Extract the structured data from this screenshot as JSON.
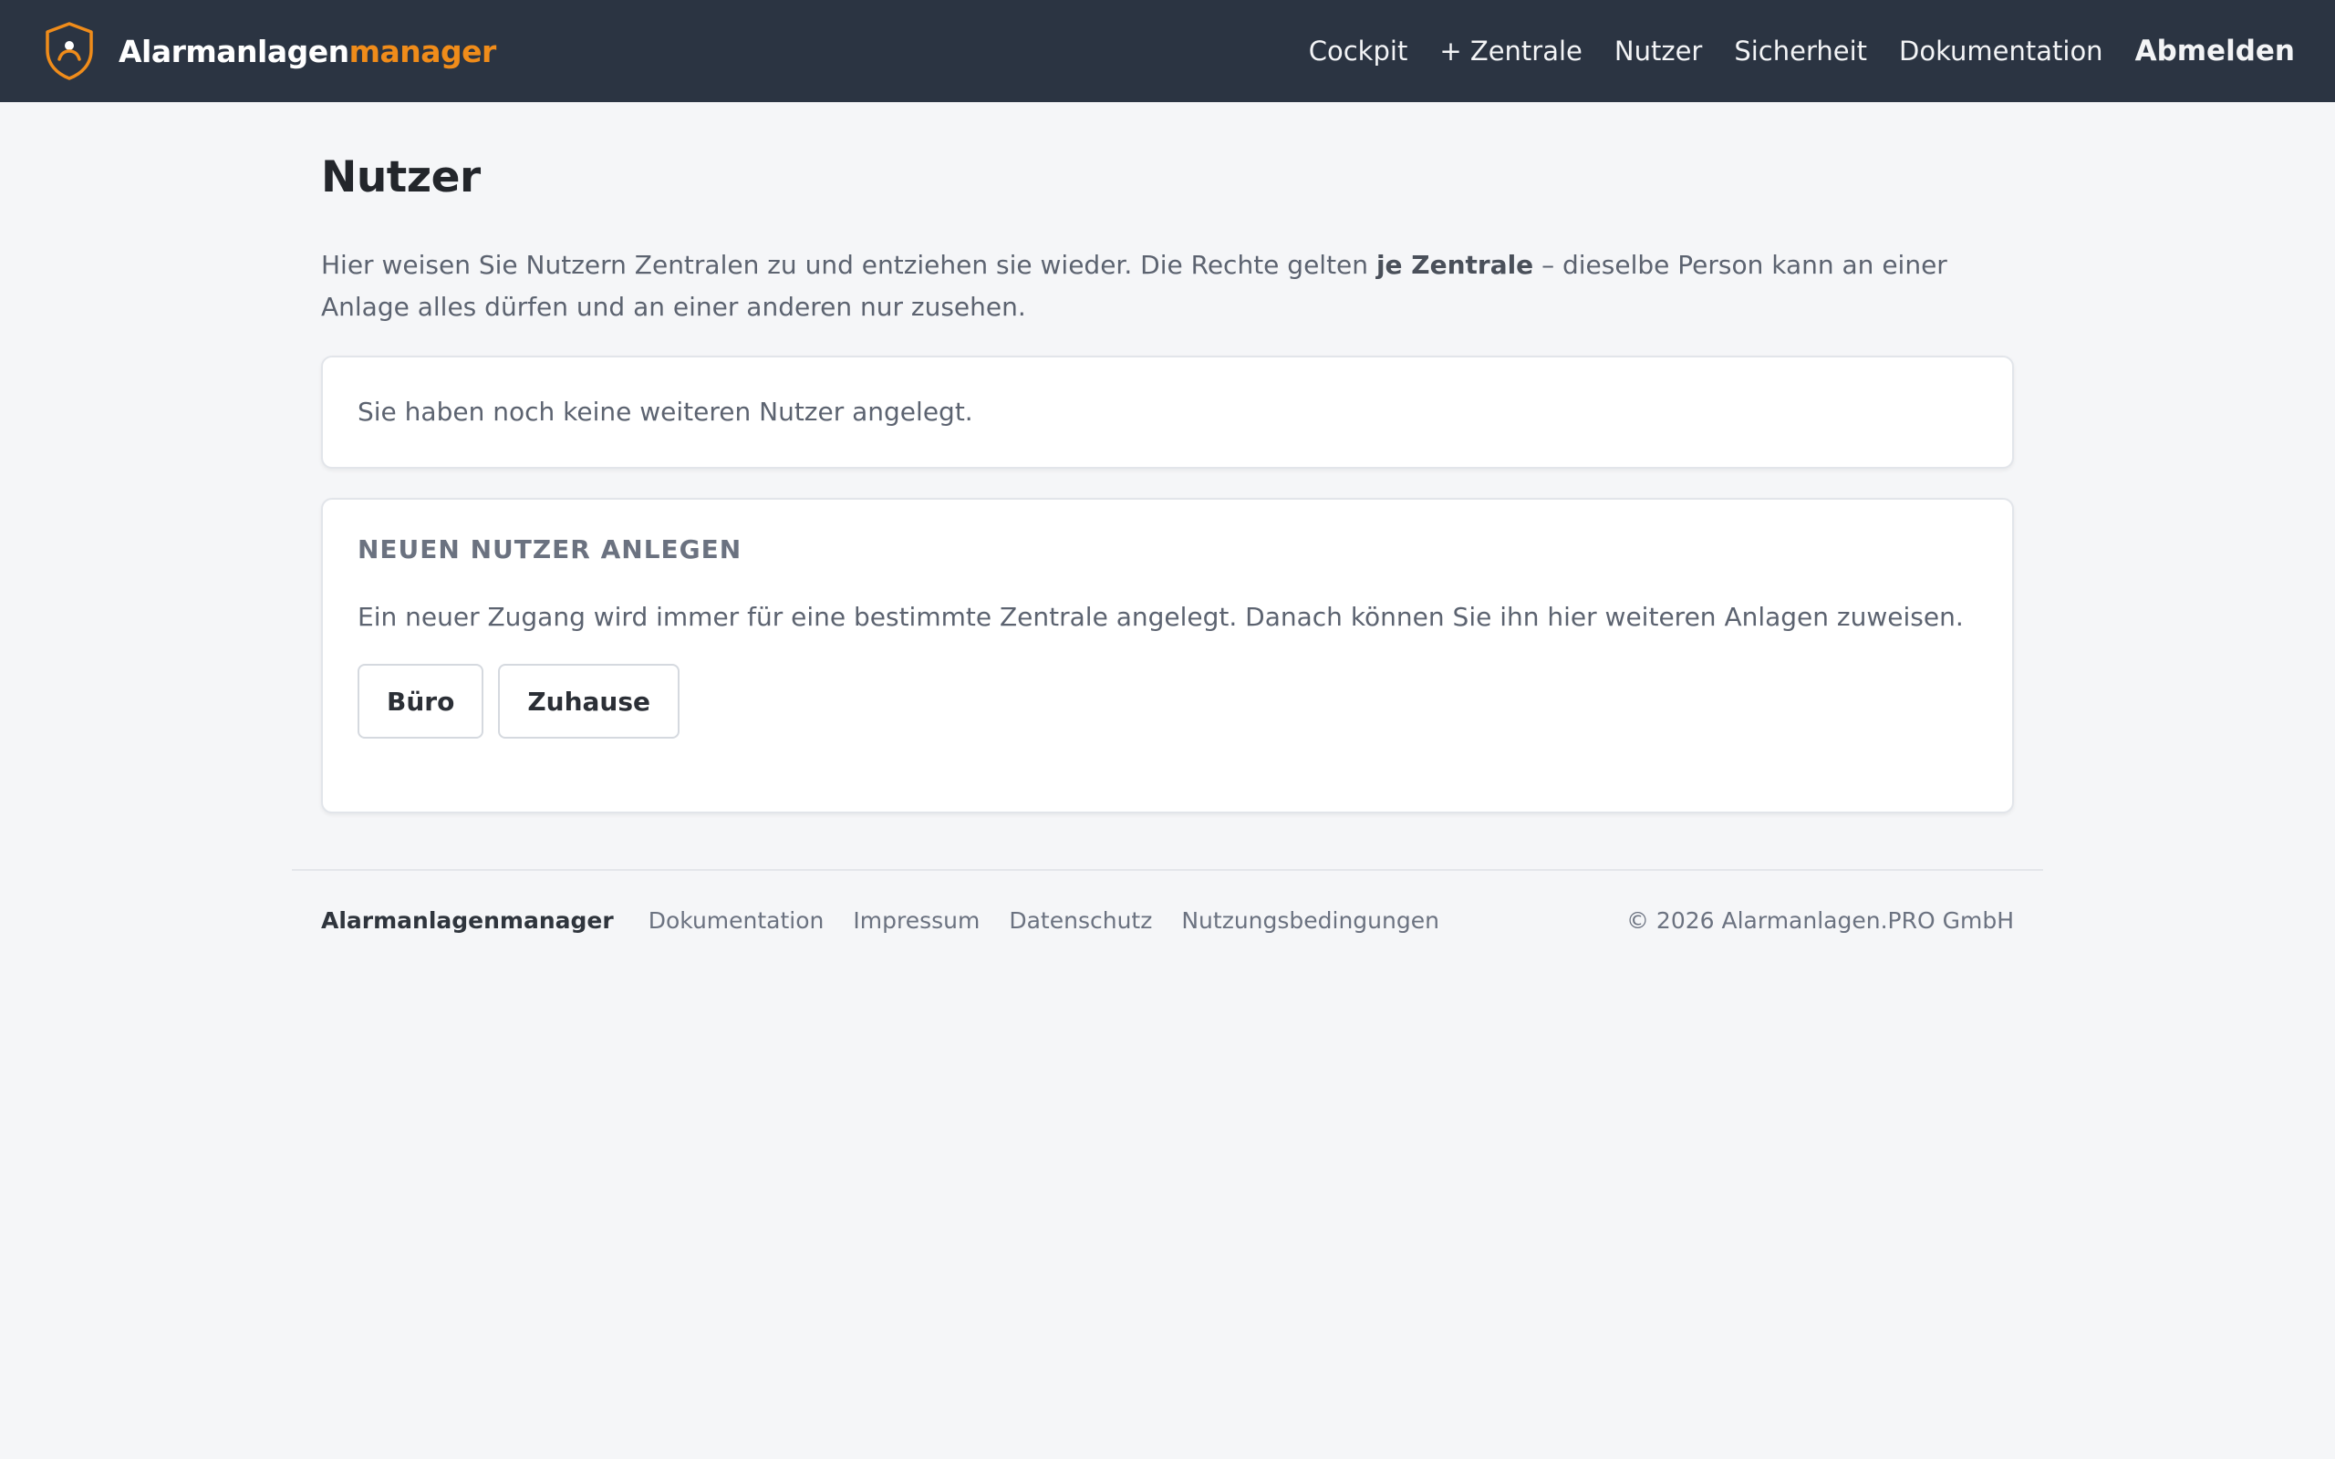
{
  "colors": {
    "topbar": "#2b3442",
    "accent": "#f08c1a",
    "background": "#f5f6f8"
  },
  "header": {
    "brand_main": "Alarmanlagen",
    "brand_accent": "manager",
    "nav": [
      {
        "label": "Cockpit"
      },
      {
        "label": "+ Zentrale"
      },
      {
        "label": "Nutzer"
      },
      {
        "label": "Sicherheit"
      },
      {
        "label": "Dokumentation"
      }
    ],
    "logout_label": "Abmelden"
  },
  "main": {
    "title": "Nutzer",
    "intro_before": "Hier weisen Sie Nutzern Zentralen zu und entziehen sie wieder. Die Rechte gelten ",
    "intro_bold": "je Zentrale",
    "intro_after": " – dieselbe Person kann an einer Anlage alles dürfen und an einer anderen nur zusehen.",
    "empty_message": "Sie haben noch keine weiteren Nutzer angelegt.",
    "create": {
      "heading": "NEUEN NUTZER ANLEGEN",
      "description": "Ein neuer Zugang wird immer für eine bestimmte Zentrale angelegt. Danach können Sie ihn hier weiteren Anlagen zuweisen.",
      "buttons": [
        {
          "label": "Büro"
        },
        {
          "label": "Zuhause"
        }
      ]
    }
  },
  "footer": {
    "brand": "Alarmanlagenmanager",
    "links": [
      {
        "label": "Dokumentation"
      },
      {
        "label": "Impressum"
      },
      {
        "label": "Datenschutz"
      },
      {
        "label": "Nutzungsbedingungen"
      }
    ],
    "copyright": "© 2026 Alarmanlagen.PRO GmbH"
  }
}
